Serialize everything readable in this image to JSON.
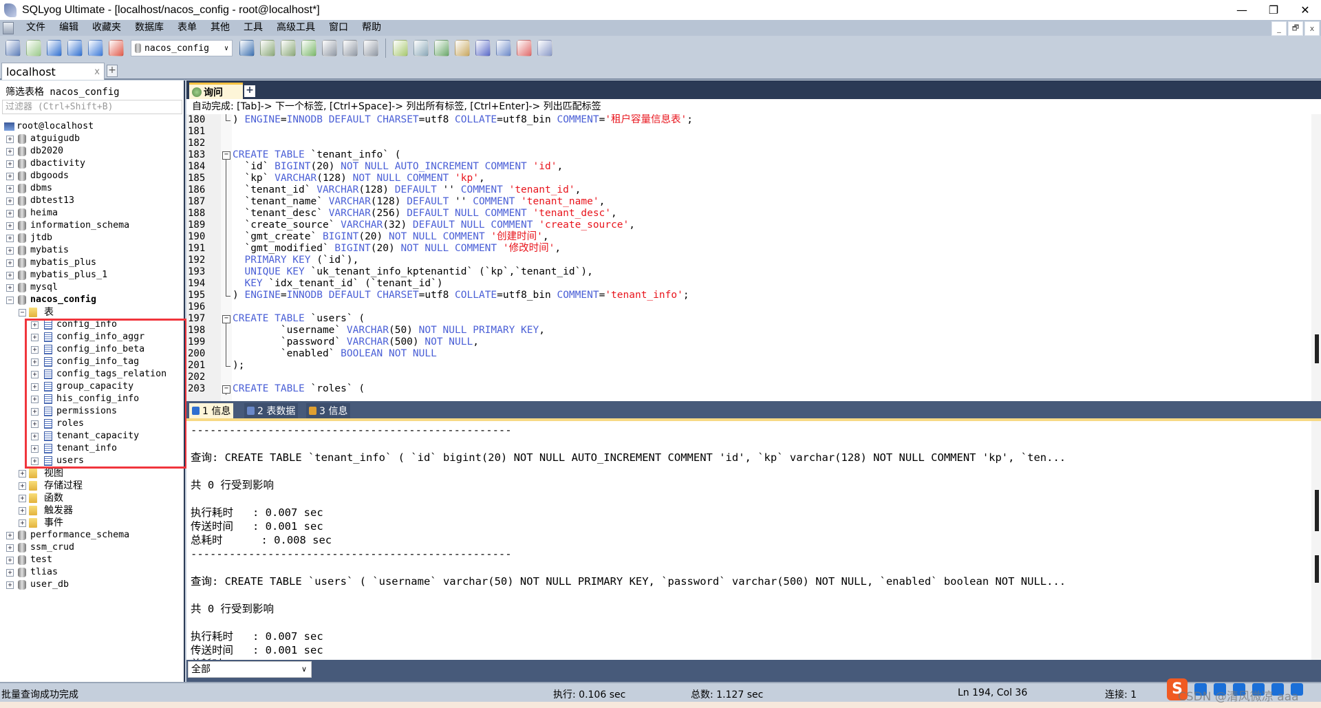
{
  "window": {
    "title": "SQLyog Ultimate - [localhost/nacos_config - root@localhost*]",
    "minimize": "—",
    "restore": "❐",
    "close": "✕"
  },
  "menu": [
    "文件",
    "编辑",
    "收藏夹",
    "数据库",
    "表单",
    "其他",
    "工具",
    "高级工具",
    "窗口",
    "帮助"
  ],
  "mdi_controls": [
    "_",
    "🗗",
    "x"
  ],
  "toolbar": {
    "icons_left": [
      {
        "name": "connection-manager-icon",
        "color": "#5a7bb8"
      },
      {
        "name": "new-query-icon",
        "color": "#9bc98a"
      },
      {
        "name": "execute-query-icon",
        "color": "#2f6fd0"
      },
      {
        "name": "execute-all-icon",
        "color": "#2f6fd0"
      },
      {
        "name": "execute-edit-icon",
        "color": "#3a78d8"
      },
      {
        "name": "schema-designer-icon",
        "color": "#e05a4a"
      }
    ],
    "database_select": "nacos_config",
    "icons_right": [
      {
        "name": "user-manager-icon",
        "color": "#3b6fb0"
      },
      {
        "name": "backup-icon",
        "color": "#8aa878"
      },
      {
        "name": "restore-icon",
        "color": "#8aa878"
      },
      {
        "name": "import-icon",
        "color": "#7ab86a"
      },
      {
        "name": "export-table-icon",
        "color": "#9098a4"
      },
      {
        "name": "table-data-icon",
        "color": "#9098a4"
      },
      {
        "name": "copy-table-icon",
        "color": "#9098a4"
      },
      {
        "name": "sep"
      },
      {
        "name": "sql-script-icon",
        "color": "#a8c870"
      },
      {
        "name": "db-sync-icon",
        "color": "#8aa8b8"
      },
      {
        "name": "compare-icon",
        "color": "#6aa86a"
      },
      {
        "name": "migration-icon",
        "color": "#c8a860"
      },
      {
        "name": "query-builder-icon",
        "color": "#5a6ac8"
      },
      {
        "name": "report-icon",
        "color": "#6a88c8"
      },
      {
        "name": "schedule-icon",
        "color": "#e06a6a"
      },
      {
        "name": "structure-icon",
        "color": "#8a9ac8"
      }
    ]
  },
  "connection_tab": {
    "label": "localhost",
    "close": "x",
    "add": "+"
  },
  "sidebar": {
    "filter_label": "筛选表格 nacos_config",
    "filter_placeholder": "过滤器 (Ctrl+Shift+B)",
    "tree": [
      {
        "label": "root@localhost",
        "level": -1,
        "icon": "server"
      },
      {
        "label": "atguigudb",
        "level": 0,
        "icon": "db",
        "exp": "+"
      },
      {
        "label": "db2020",
        "level": 0,
        "icon": "db",
        "exp": "+"
      },
      {
        "label": "dbactivity",
        "level": 0,
        "icon": "db",
        "exp": "+"
      },
      {
        "label": "dbgoods",
        "level": 0,
        "icon": "db",
        "exp": "+"
      },
      {
        "label": "dbms",
        "level": 0,
        "icon": "db",
        "exp": "+"
      },
      {
        "label": "dbtest13",
        "level": 0,
        "icon": "db",
        "exp": "+"
      },
      {
        "label": "heima",
        "level": 0,
        "icon": "db",
        "exp": "+"
      },
      {
        "label": "information_schema",
        "level": 0,
        "icon": "db",
        "exp": "+"
      },
      {
        "label": "jtdb",
        "level": 0,
        "icon": "db",
        "exp": "+"
      },
      {
        "label": "mybatis",
        "level": 0,
        "icon": "db",
        "exp": "+"
      },
      {
        "label": "mybatis_plus",
        "level": 0,
        "icon": "db",
        "exp": "+"
      },
      {
        "label": "mybatis_plus_1",
        "level": 0,
        "icon": "db",
        "exp": "+"
      },
      {
        "label": "mysql",
        "level": 0,
        "icon": "db",
        "exp": "+"
      },
      {
        "label": "nacos_config",
        "level": 0,
        "icon": "db",
        "exp": "−",
        "bold": true
      },
      {
        "label": "表",
        "level": 1,
        "icon": "folder",
        "exp": "−"
      },
      {
        "label": "config_info",
        "level": 2,
        "icon": "table",
        "exp": "+"
      },
      {
        "label": "config_info_aggr",
        "level": 2,
        "icon": "table",
        "exp": "+"
      },
      {
        "label": "config_info_beta",
        "level": 2,
        "icon": "table",
        "exp": "+"
      },
      {
        "label": "config_info_tag",
        "level": 2,
        "icon": "table",
        "exp": "+"
      },
      {
        "label": "config_tags_relation",
        "level": 2,
        "icon": "table",
        "exp": "+"
      },
      {
        "label": "group_capacity",
        "level": 2,
        "icon": "table",
        "exp": "+"
      },
      {
        "label": "his_config_info",
        "level": 2,
        "icon": "table",
        "exp": "+"
      },
      {
        "label": "permissions",
        "level": 2,
        "icon": "table",
        "exp": "+"
      },
      {
        "label": "roles",
        "level": 2,
        "icon": "table",
        "exp": "+"
      },
      {
        "label": "tenant_capacity",
        "level": 2,
        "icon": "table",
        "exp": "+"
      },
      {
        "label": "tenant_info",
        "level": 2,
        "icon": "table",
        "exp": "+"
      },
      {
        "label": "users",
        "level": 2,
        "icon": "table",
        "exp": "+"
      },
      {
        "label": "视图",
        "level": 1,
        "icon": "folder",
        "exp": "+"
      },
      {
        "label": "存储过程",
        "level": 1,
        "icon": "folder",
        "exp": "+"
      },
      {
        "label": "函数",
        "level": 1,
        "icon": "folder",
        "exp": "+"
      },
      {
        "label": "触发器",
        "level": 1,
        "icon": "folder",
        "exp": "+"
      },
      {
        "label": "事件",
        "level": 1,
        "icon": "folder",
        "exp": "+"
      },
      {
        "label": "performance_schema",
        "level": 0,
        "icon": "db",
        "exp": "+"
      },
      {
        "label": "ssm_crud",
        "level": 0,
        "icon": "db",
        "exp": "+"
      },
      {
        "label": "test",
        "level": 0,
        "icon": "db",
        "exp": "+"
      },
      {
        "label": "tlias",
        "level": 0,
        "icon": "db",
        "exp": "+"
      },
      {
        "label": "user_db",
        "level": 0,
        "icon": "db",
        "exp": "+"
      }
    ]
  },
  "query_tab": {
    "label": "询问",
    "add": "+"
  },
  "autocomplete_hint": "自动完成: [Tab]-> 下一个标签, [Ctrl+Space]-> 列出所有标签, [Ctrl+Enter]-> 列出匹配标签",
  "editor": {
    "colors": {
      "keyword": "#4a5fd6",
      "string": "#e8141c"
    },
    "lines": [
      {
        "n": "180",
        "fold": "end",
        "segs": [
          {
            "t": "n",
            "v": ") "
          },
          {
            "t": "k",
            "v": "ENGINE"
          },
          {
            "t": "n",
            "v": "="
          },
          {
            "t": "k",
            "v": "INNODB DEFAULT CHARSET"
          },
          {
            "t": "n",
            "v": "=utf8 "
          },
          {
            "t": "k",
            "v": "COLLATE"
          },
          {
            "t": "n",
            "v": "=utf8_bin "
          },
          {
            "t": "k",
            "v": "COMMENT"
          },
          {
            "t": "n",
            "v": "="
          },
          {
            "t": "s",
            "v": "'租户容量信息表'"
          },
          {
            "t": "n",
            "v": ";"
          }
        ]
      },
      {
        "n": "181",
        "fold": "",
        "segs": []
      },
      {
        "n": "182",
        "fold": "",
        "segs": []
      },
      {
        "n": "183",
        "fold": "start",
        "segs": [
          {
            "t": "k",
            "v": "CREATE TABLE"
          },
          {
            "t": "n",
            "v": " `tenant_info` ("
          }
        ]
      },
      {
        "n": "184",
        "fold": "mid",
        "segs": [
          {
            "t": "n",
            "v": "  `id` "
          },
          {
            "t": "k",
            "v": "BIGINT"
          },
          {
            "t": "n",
            "v": "(20) "
          },
          {
            "t": "k",
            "v": "NOT NULL AUTO_INCREMENT COMMENT"
          },
          {
            "t": "n",
            "v": " "
          },
          {
            "t": "s",
            "v": "'id'"
          },
          {
            "t": "n",
            "v": ","
          }
        ]
      },
      {
        "n": "185",
        "fold": "mid",
        "segs": [
          {
            "t": "n",
            "v": "  `kp` "
          },
          {
            "t": "k",
            "v": "VARCHAR"
          },
          {
            "t": "n",
            "v": "(128) "
          },
          {
            "t": "k",
            "v": "NOT NULL COMMENT"
          },
          {
            "t": "n",
            "v": " "
          },
          {
            "t": "s",
            "v": "'kp'"
          },
          {
            "t": "n",
            "v": ","
          }
        ]
      },
      {
        "n": "186",
        "fold": "mid",
        "segs": [
          {
            "t": "n",
            "v": "  `tenant_id` "
          },
          {
            "t": "k",
            "v": "VARCHAR"
          },
          {
            "t": "n",
            "v": "(128) "
          },
          {
            "t": "k",
            "v": "DEFAULT"
          },
          {
            "t": "n",
            "v": " '' "
          },
          {
            "t": "k",
            "v": "COMMENT"
          },
          {
            "t": "n",
            "v": " "
          },
          {
            "t": "s",
            "v": "'tenant_id'"
          },
          {
            "t": "n",
            "v": ","
          }
        ]
      },
      {
        "n": "187",
        "fold": "mid",
        "segs": [
          {
            "t": "n",
            "v": "  `tenant_name` "
          },
          {
            "t": "k",
            "v": "VARCHAR"
          },
          {
            "t": "n",
            "v": "(128) "
          },
          {
            "t": "k",
            "v": "DEFAULT"
          },
          {
            "t": "n",
            "v": " '' "
          },
          {
            "t": "k",
            "v": "COMMENT"
          },
          {
            "t": "n",
            "v": " "
          },
          {
            "t": "s",
            "v": "'tenant_name'"
          },
          {
            "t": "n",
            "v": ","
          }
        ]
      },
      {
        "n": "188",
        "fold": "mid",
        "segs": [
          {
            "t": "n",
            "v": "  `tenant_desc` "
          },
          {
            "t": "k",
            "v": "VARCHAR"
          },
          {
            "t": "n",
            "v": "(256) "
          },
          {
            "t": "k",
            "v": "DEFAULT NULL COMMENT"
          },
          {
            "t": "n",
            "v": " "
          },
          {
            "t": "s",
            "v": "'tenant_desc'"
          },
          {
            "t": "n",
            "v": ","
          }
        ]
      },
      {
        "n": "189",
        "fold": "mid",
        "segs": [
          {
            "t": "n",
            "v": "  `create_source` "
          },
          {
            "t": "k",
            "v": "VARCHAR"
          },
          {
            "t": "n",
            "v": "(32) "
          },
          {
            "t": "k",
            "v": "DEFAULT NULL COMMENT"
          },
          {
            "t": "n",
            "v": " "
          },
          {
            "t": "s",
            "v": "'create_source'"
          },
          {
            "t": "n",
            "v": ","
          }
        ]
      },
      {
        "n": "190",
        "fold": "mid",
        "segs": [
          {
            "t": "n",
            "v": "  `gmt_create` "
          },
          {
            "t": "k",
            "v": "BIGINT"
          },
          {
            "t": "n",
            "v": "(20) "
          },
          {
            "t": "k",
            "v": "NOT NULL COMMENT"
          },
          {
            "t": "n",
            "v": " "
          },
          {
            "t": "s",
            "v": "'创建时间'"
          },
          {
            "t": "n",
            "v": ","
          }
        ]
      },
      {
        "n": "191",
        "fold": "mid",
        "segs": [
          {
            "t": "n",
            "v": "  `gmt_modified` "
          },
          {
            "t": "k",
            "v": "BIGINT"
          },
          {
            "t": "n",
            "v": "(20) "
          },
          {
            "t": "k",
            "v": "NOT NULL COMMENT"
          },
          {
            "t": "n",
            "v": " "
          },
          {
            "t": "s",
            "v": "'修改时间'"
          },
          {
            "t": "n",
            "v": ","
          }
        ]
      },
      {
        "n": "192",
        "fold": "mid",
        "segs": [
          {
            "t": "n",
            "v": "  "
          },
          {
            "t": "k",
            "v": "PRIMARY KEY"
          },
          {
            "t": "n",
            "v": " (`id`),"
          }
        ]
      },
      {
        "n": "193",
        "fold": "mid",
        "segs": [
          {
            "t": "n",
            "v": "  "
          },
          {
            "t": "k",
            "v": "UNIQUE KEY"
          },
          {
            "t": "n",
            "v": " `uk_tenant_info_kptenantid` (`kp`,`tenant_id`),"
          }
        ]
      },
      {
        "n": "194",
        "fold": "mid",
        "segs": [
          {
            "t": "n",
            "v": "  "
          },
          {
            "t": "k",
            "v": "KEY"
          },
          {
            "t": "n",
            "v": " `idx_tenant_id` (`tenant_id`)"
          }
        ]
      },
      {
        "n": "195",
        "fold": "end",
        "segs": [
          {
            "t": "n",
            "v": ") "
          },
          {
            "t": "k",
            "v": "ENGINE"
          },
          {
            "t": "n",
            "v": "="
          },
          {
            "t": "k",
            "v": "INNODB DEFAULT CHARSET"
          },
          {
            "t": "n",
            "v": "=utf8 "
          },
          {
            "t": "k",
            "v": "COLLATE"
          },
          {
            "t": "n",
            "v": "=utf8_bin "
          },
          {
            "t": "k",
            "v": "COMMENT"
          },
          {
            "t": "n",
            "v": "="
          },
          {
            "t": "s",
            "v": "'tenant_info'"
          },
          {
            "t": "n",
            "v": ";"
          }
        ]
      },
      {
        "n": "196",
        "fold": "",
        "segs": []
      },
      {
        "n": "197",
        "fold": "start",
        "segs": [
          {
            "t": "k",
            "v": "CREATE TABLE"
          },
          {
            "t": "n",
            "v": " `users` ("
          }
        ]
      },
      {
        "n": "198",
        "fold": "mid",
        "segs": [
          {
            "t": "n",
            "v": "        `username` "
          },
          {
            "t": "k",
            "v": "VARCHAR"
          },
          {
            "t": "n",
            "v": "(50) "
          },
          {
            "t": "k",
            "v": "NOT NULL PRIMARY KEY"
          },
          {
            "t": "n",
            "v": ","
          }
        ]
      },
      {
        "n": "199",
        "fold": "mid",
        "segs": [
          {
            "t": "n",
            "v": "        `password` "
          },
          {
            "t": "k",
            "v": "VARCHAR"
          },
          {
            "t": "n",
            "v": "(500) "
          },
          {
            "t": "k",
            "v": "NOT NULL"
          },
          {
            "t": "n",
            "v": ","
          }
        ]
      },
      {
        "n": "200",
        "fold": "mid",
        "segs": [
          {
            "t": "n",
            "v": "        `enabled` "
          },
          {
            "t": "k",
            "v": "BOOLEAN NOT NULL"
          }
        ]
      },
      {
        "n": "201",
        "fold": "end",
        "segs": [
          {
            "t": "n",
            "v": ");"
          }
        ]
      },
      {
        "n": "202",
        "fold": "",
        "segs": []
      },
      {
        "n": "203",
        "fold": "start",
        "segs": [
          {
            "t": "k",
            "v": "CREATE TABLE"
          },
          {
            "t": "n",
            "v": " `roles` ("
          }
        ]
      }
    ]
  },
  "result_tabs": [
    {
      "label": "1 信息",
      "active": true,
      "icon": "info-icon",
      "color": "#2f6fd0"
    },
    {
      "label": "2 表数据",
      "active": false,
      "icon": "table-data-icon",
      "color": "#6a88c8"
    },
    {
      "label": "3 信息",
      "active": false,
      "icon": "profile-icon",
      "color": "#e0a030"
    }
  ],
  "results": [
    "--------------------------------------------------",
    "",
    "查询: CREATE TABLE `tenant_info` ( `id` bigint(20) NOT NULL AUTO_INCREMENT COMMENT 'id', `kp` varchar(128) NOT NULL COMMENT 'kp', `ten...",
    "",
    "共 0 行受到影响",
    "",
    "执行耗时   : 0.007 sec",
    "传送时间   : 0.001 sec",
    "总耗时      : 0.008 sec",
    "--------------------------------------------------",
    "",
    "查询: CREATE TABLE `users` ( `username` varchar(50) NOT NULL PRIMARY KEY, `password` varchar(500) NOT NULL, `enabled` boolean NOT NULL...",
    "",
    "共 0 行受到影响",
    "",
    "执行耗时   : 0.007 sec",
    "传送时间   : 0.001 sec",
    "总耗时"
  ],
  "result_filter": {
    "value": "全部"
  },
  "status": {
    "message": "批量查询成功完成",
    "exec": "执行: 0.106 sec",
    "total": "总数: 1.127 sec",
    "position": "Ln 194, Col 36",
    "connections": "连接: 1"
  },
  "ime": {
    "logo": "S"
  },
  "watermark": "CSDN @清风微凉 aaa"
}
